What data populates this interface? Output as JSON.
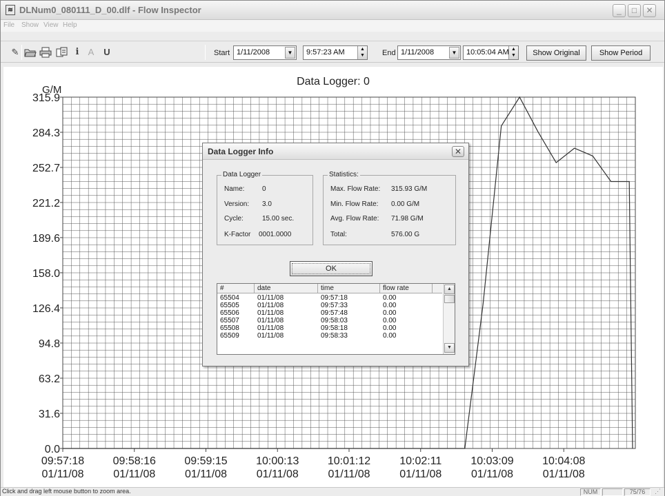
{
  "window": {
    "title": "DLNum0_080111_D_00.dlf - Flow Inspector",
    "app_icon": "flow-inspector-app-icon",
    "controls": [
      "minimize-icon",
      "maximize-icon",
      "close-icon"
    ]
  },
  "menu": [
    "File",
    "Show",
    "View",
    "Help"
  ],
  "toolbar": {
    "icons": [
      "pen-icon",
      "open-folder-icon",
      "print-icon",
      "export-icon",
      "info-icon",
      "font-icon",
      "underline-icon"
    ],
    "info_glyph": "i",
    "font_glyph": "A",
    "underline_glyph": "U",
    "start_label": "Start",
    "start_date": "1/11/2008",
    "start_time": "9:57:23 AM",
    "end_label": "End",
    "end_date": "1/11/2008",
    "end_time": "10:05:04 AM",
    "show_original": "Show Original",
    "show_period": "Show Period"
  },
  "chart_data": {
    "type": "line",
    "title": "Data Logger: 0",
    "ylabel": "G/M",
    "yticks": [
      "0.0",
      "31.6",
      "63.2",
      "94.8",
      "126.4",
      "158.0",
      "189.6",
      "221.2",
      "252.7",
      "284.3",
      "315.9"
    ],
    "ylim": [
      0,
      315.9
    ],
    "xticks": [
      {
        "time": "09:57:18",
        "date": "01/11/08"
      },
      {
        "time": "09:58:16",
        "date": "01/11/08"
      },
      {
        "time": "09:59:15",
        "date": "01/11/08"
      },
      {
        "time": "10:00:13",
        "date": "01/11/08"
      },
      {
        "time": "10:01:12",
        "date": "01/11/08"
      },
      {
        "time": "10:02:11",
        "date": "01/11/08"
      },
      {
        "time": "10:03:09",
        "date": "01/11/08"
      },
      {
        "time": "10:04:08",
        "date": "01/11/08"
      }
    ],
    "x_seconds_range": [
      0,
      470
    ],
    "grid": true,
    "series": [
      {
        "x": [
          0,
          15,
          30,
          45,
          60,
          75,
          90,
          105,
          120,
          135,
          150,
          165,
          180,
          195,
          210,
          225,
          240,
          255,
          270,
          285,
          300,
          315,
          330,
          345,
          360,
          375,
          390,
          405,
          420,
          435,
          450,
          465
        ],
        "y": [
          0,
          0,
          0,
          0,
          0,
          0,
          0,
          0,
          0,
          0,
          0,
          0,
          0,
          0,
          0,
          0,
          0,
          0,
          0,
          0,
          0,
          0,
          0,
          130,
          290,
          315.93,
          285,
          257,
          270,
          263,
          240,
          240
        ],
        "color": "#333333"
      }
    ]
  },
  "dialog": {
    "title": "Data Logger Info",
    "close_icon": "close-icon",
    "data_logger_group": {
      "legend": "Data Logger",
      "items": [
        {
          "label": "Name:",
          "value": "0"
        },
        {
          "label": "Version:",
          "value": "3.0"
        },
        {
          "label": "Cycle:",
          "value": "15.00 sec."
        },
        {
          "label": "K-Factor",
          "value": "0001.0000"
        }
      ]
    },
    "statistics_group": {
      "legend": "Statistics:",
      "items": [
        {
          "label": "Max. Flow Rate:",
          "value": "315.93 G/M"
        },
        {
          "label": "Min. Flow Rate:",
          "value": "0.00 G/M"
        },
        {
          "label": "Avg. Flow Rate:",
          "value": "71.98 G/M"
        },
        {
          "label": "Total:",
          "value": "576.00 G"
        }
      ]
    },
    "ok_label": "OK",
    "table": {
      "columns": [
        "#",
        "date",
        "time",
        "flow rate"
      ],
      "rows": [
        [
          "65504",
          "01/11/08",
          "09:57:18",
          "0.00"
        ],
        [
          "65505",
          "01/11/08",
          "09:57:33",
          "0.00"
        ],
        [
          "65506",
          "01/11/08",
          "09:57:48",
          "0.00"
        ],
        [
          "65507",
          "01/11/08",
          "09:58:03",
          "0.00"
        ],
        [
          "65508",
          "01/11/08",
          "09:58:18",
          "0.00"
        ],
        [
          "65509",
          "01/11/08",
          "09:58:33",
          "0.00"
        ]
      ]
    }
  },
  "status": {
    "hint": "Click and drag left mouse button to zoom area.",
    "num": "NUM",
    "page": "75/76"
  }
}
